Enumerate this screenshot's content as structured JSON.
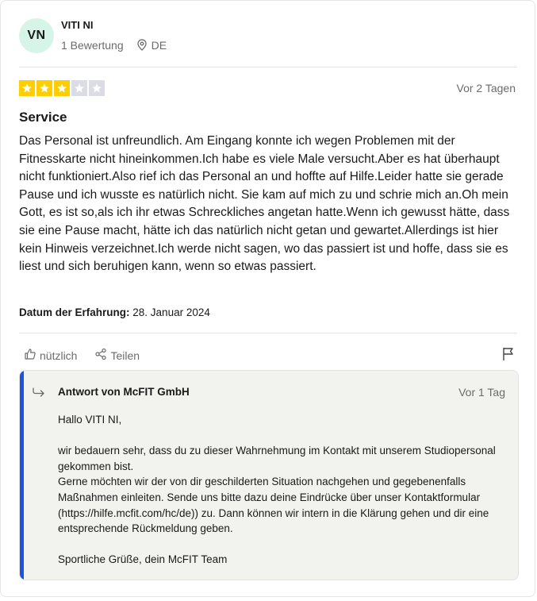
{
  "reviewer": {
    "initials": "VN",
    "name": "VITI NI",
    "review_count": "1 Bewertung",
    "country": "DE"
  },
  "review": {
    "rating": 3,
    "max_rating": 5,
    "date": "Vor 2 Tagen",
    "title": "Service",
    "text": "Das Personal ist unfreundlich. Am Eingang konnte ich wegen Problemen mit der Fitnesskarte nicht hineinkommen.Ich habe es viele Male versucht.Aber es hat überhaupt nicht funktioniert.Also rief ich das Personal an und hoffte auf Hilfe.Leider hatte sie gerade Pause und ich wusste es natürlich nicht. Sie kam auf mich zu und schrie mich an.Oh mein Gott, es ist so,als ich ihr etwas Schreckliches angetan hatte.Wenn ich gewusst hätte, dass sie eine Pause macht, hätte ich das natürlich nicht getan und gewartet.Allerdings ist hier kein Hinweis verzeichnet.Ich werde nicht sagen, wo das passiert ist und hoffe, dass sie es liest und sich beruhigen kann, wenn so etwas passiert.",
    "experience_label": "Datum der Erfahrung:",
    "experience_date": "28. Januar 2024"
  },
  "actions": {
    "useful_label": "nützlich",
    "share_label": "Teilen"
  },
  "reply": {
    "title": "Antwort von McFIT GmbH",
    "date": "Vor 1 Tag",
    "greeting": "Hallo VITI NI,",
    "paragraph1_line1": "wir bedauern sehr, dass du zu dieser Wahrnehmung im Kontakt mit unserem Studiopersonal gekommen bist.",
    "paragraph1_line2": "Gerne möchten wir der von dir geschilderten Situation nachgehen und gegebenenfalls Maßnahmen einleiten. Sende uns bitte dazu deine Eindrücke über unser Kontaktformular (https://hilfe.mcfit.com/hc/de)) zu. Dann können wir intern in die Klärung gehen und dir eine entsprechende Rückmeldung geben.",
    "signoff": "Sportliche Grüße, dein McFIT Team"
  },
  "colors": {
    "star_on": "#ffce00",
    "star_off": "#dcdce6",
    "reply_accent": "#1c53e0",
    "avatar_bg": "#d6f5e8"
  }
}
